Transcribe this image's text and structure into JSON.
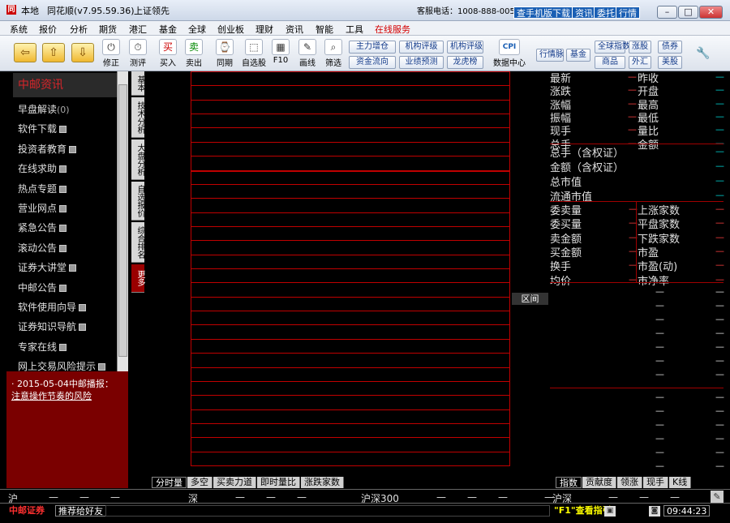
{
  "titlebar": {
    "logo": "同",
    "location": "本地",
    "app_name": "同花顺(v7.95.59.36)",
    "broker": "上证领先",
    "hotline": "客服电话：1008-888-005",
    "links": [
      "查手机版下载",
      "资讯",
      "委托",
      "行情"
    ]
  },
  "menu": [
    "系统",
    "报价",
    "分析",
    "期货",
    "港汇",
    "基金",
    "全球",
    "创业板",
    "理财",
    "资讯",
    "智能",
    "工具",
    "在线服务"
  ],
  "toolbar": {
    "back": "⇦",
    "up": "⇧",
    "down": "⇩",
    "buttons": [
      {
        "icon": "⏻",
        "label": "修正"
      },
      {
        "icon": "⏱",
        "label": "测评"
      },
      {
        "icon": "买",
        "label": "买入"
      },
      {
        "icon": "卖",
        "label": "卖出"
      },
      {
        "icon": "⌚",
        "label": "同期"
      },
      {
        "icon": "⬚",
        "label": "自选股"
      },
      {
        "icon": "▦",
        "label": "F10"
      },
      {
        "icon": "✎",
        "label": "画线"
      },
      {
        "icon": "⌕",
        "label": "筛选"
      }
    ],
    "small": [
      "主力增仓",
      "机构评级",
      "机构评级",
      "资金流向",
      "业绩预测",
      "龙虎榜",
      "全球指数",
      "涨股",
      "债券",
      "外汇",
      "美股",
      "商品",
      "基金"
    ],
    "cpi_label": "CPI",
    "cpi_caption": "数据中心",
    "tool_label": "行情脉",
    "wrench": "🔧"
  },
  "left_panel": {
    "header": "中邮资讯",
    "items": [
      {
        "label": "早盘解读",
        "suffix": "(0)"
      },
      {
        "label": "软件下载",
        "suffix": ""
      },
      {
        "label": "投资者教育",
        "suffix": ""
      },
      {
        "label": "在线求助",
        "suffix": ""
      },
      {
        "label": "热点专题",
        "suffix": ""
      },
      {
        "label": "营业网点",
        "suffix": ""
      },
      {
        "label": "紧急公告",
        "suffix": ""
      },
      {
        "label": "滚动公告",
        "suffix": ""
      },
      {
        "label": "证券大讲堂",
        "suffix": ""
      },
      {
        "label": "中邮公告",
        "suffix": ""
      },
      {
        "label": "软件使用向导",
        "suffix": ""
      },
      {
        "label": "证券知识导航",
        "suffix": ""
      },
      {
        "label": "专家在线",
        "suffix": ""
      },
      {
        "label": "网上交易风险提示",
        "suffix": ""
      }
    ],
    "news_prefix": "· 2015-05-04中邮播报：",
    "news_link": "注意操作节奏的风险"
  },
  "vtabs": [
    "基本",
    "技术分析",
    "大盘分析",
    "自选报价",
    "综合排名",
    "更多"
  ],
  "chart": {
    "range_button": "区间"
  },
  "right_panel": {
    "left_labels": [
      "最新",
      "涨跌",
      "涨幅",
      "振幅",
      "现手",
      "总手"
    ],
    "right_labels": [
      "昨收",
      "开盘",
      "最高",
      "最低",
      "量比",
      "金额"
    ],
    "wide_labels": [
      "总手（含权证）",
      "金额（含权证）",
      "总市值",
      "流通市值"
    ],
    "left2": [
      "委卖量",
      "委买量",
      "卖金额",
      "买金额",
      "换手",
      "均价"
    ],
    "right2": [
      "上涨家数",
      "平盘家数",
      "下跌家数",
      "市盈",
      "市盈(动)",
      "市净率"
    ],
    "dash": "—"
  },
  "bottom_tabs_left": [
    "分时量",
    "多空",
    "买卖力道",
    "即时量比",
    "涨跌家数"
  ],
  "bottom_tabs_right": [
    "指数",
    "贡献度",
    "领涨",
    "现手",
    "K线"
  ],
  "index_bar": {
    "sh": "沪",
    "sz": "深",
    "hs300": "沪深300",
    "hushen": "沪深",
    "dash": "—"
  },
  "status": {
    "broker": "中邮证券",
    "recommend": "推荐给好友",
    "help": "\"F1\"查看指引",
    "time": "09:44:23"
  },
  "colors": {
    "grid": "#c00000",
    "accent": "#d40000",
    "news_bg": "#7a0000"
  }
}
